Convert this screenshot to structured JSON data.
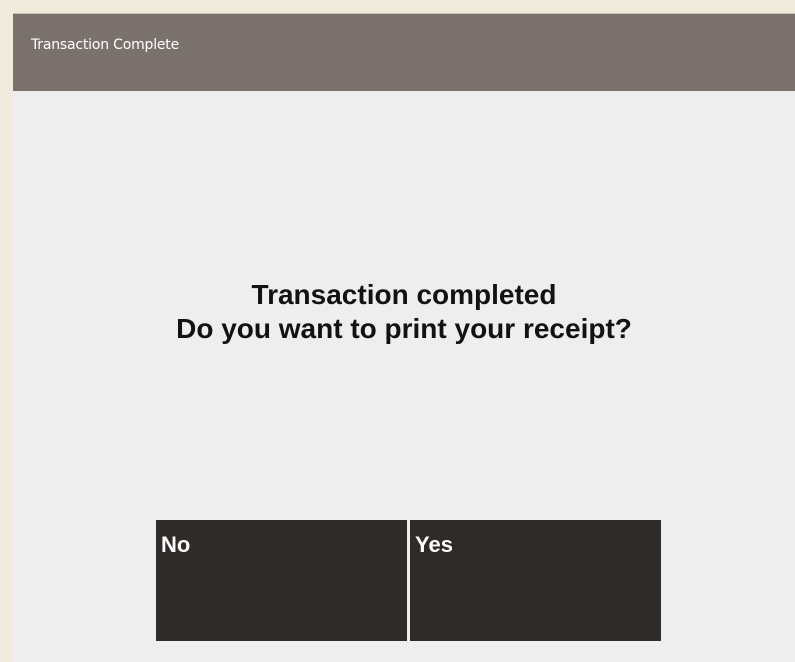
{
  "header": {
    "title": "Transaction Complete"
  },
  "main": {
    "message_line1": "Transaction completed",
    "message_line2": "Do you want to print your receipt?"
  },
  "buttons": {
    "no_label": "No",
    "yes_label": "Yes"
  },
  "colors": {
    "titlebar": "#7b716c",
    "background": "#eeeeee",
    "button": "#2f2b28",
    "button_text": "#ffffff"
  }
}
